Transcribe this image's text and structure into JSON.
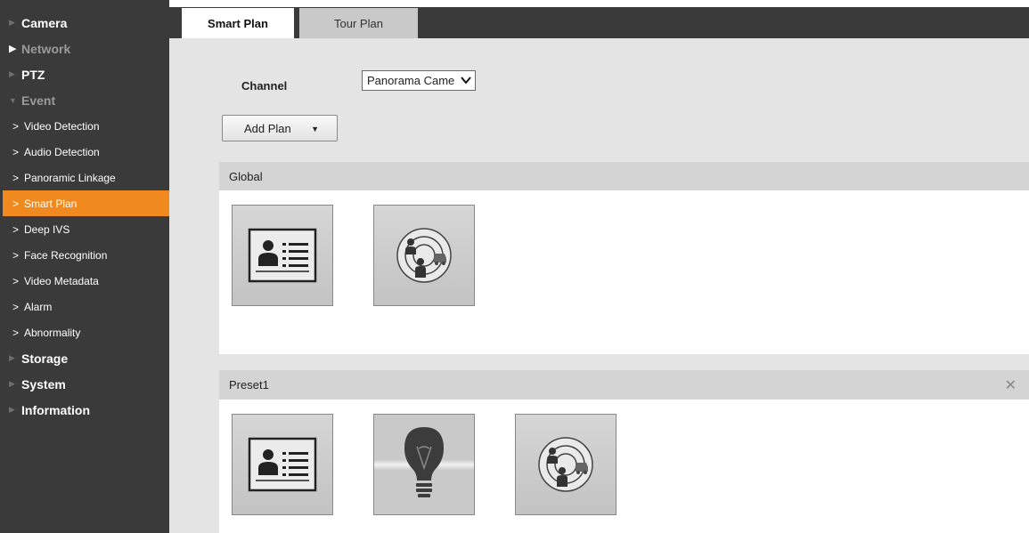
{
  "sidebar": {
    "items": [
      {
        "label": "Camera",
        "style": "top",
        "dim": false
      },
      {
        "label": "Network",
        "style": "top",
        "dim": true
      },
      {
        "label": "PTZ",
        "style": "top",
        "dim": false
      },
      {
        "label": "Event",
        "style": "top",
        "dim": true,
        "expanded": true
      },
      {
        "label": "Video Detection",
        "style": "sub"
      },
      {
        "label": "Audio Detection",
        "style": "sub"
      },
      {
        "label": "Panoramic Linkage",
        "style": "sub"
      },
      {
        "label": "Smart Plan",
        "style": "sub",
        "active": true
      },
      {
        "label": "Deep IVS",
        "style": "sub"
      },
      {
        "label": "Face Recognition",
        "style": "sub"
      },
      {
        "label": "Video Metadata",
        "style": "sub"
      },
      {
        "label": "Alarm",
        "style": "sub"
      },
      {
        "label": "Abnormality",
        "style": "sub"
      },
      {
        "label": "Storage",
        "style": "top",
        "dim": false
      },
      {
        "label": "System",
        "style": "top",
        "dim": false
      },
      {
        "label": "Information",
        "style": "top",
        "dim": false
      }
    ]
  },
  "tabs": [
    {
      "label": "Smart Plan",
      "active": true
    },
    {
      "label": "Tour Plan",
      "active": false
    }
  ],
  "channel": {
    "label": "Channel",
    "value": "Panorama Came"
  },
  "add_plan": {
    "label": "Add Plan"
  },
  "panels": [
    {
      "title": "Global",
      "closable": false,
      "icons": [
        "face-detection-icon",
        "people-counting-radar-icon"
      ]
    },
    {
      "title": "Preset1",
      "closable": true,
      "icons": [
        "face-detection-icon",
        "light-bulb-icon",
        "people-counting-radar-icon"
      ]
    }
  ],
  "colors": {
    "sidebar_bg": "#3a3a3a",
    "active_item": "#f18a1e",
    "content_bg": "#e4e4e4"
  }
}
